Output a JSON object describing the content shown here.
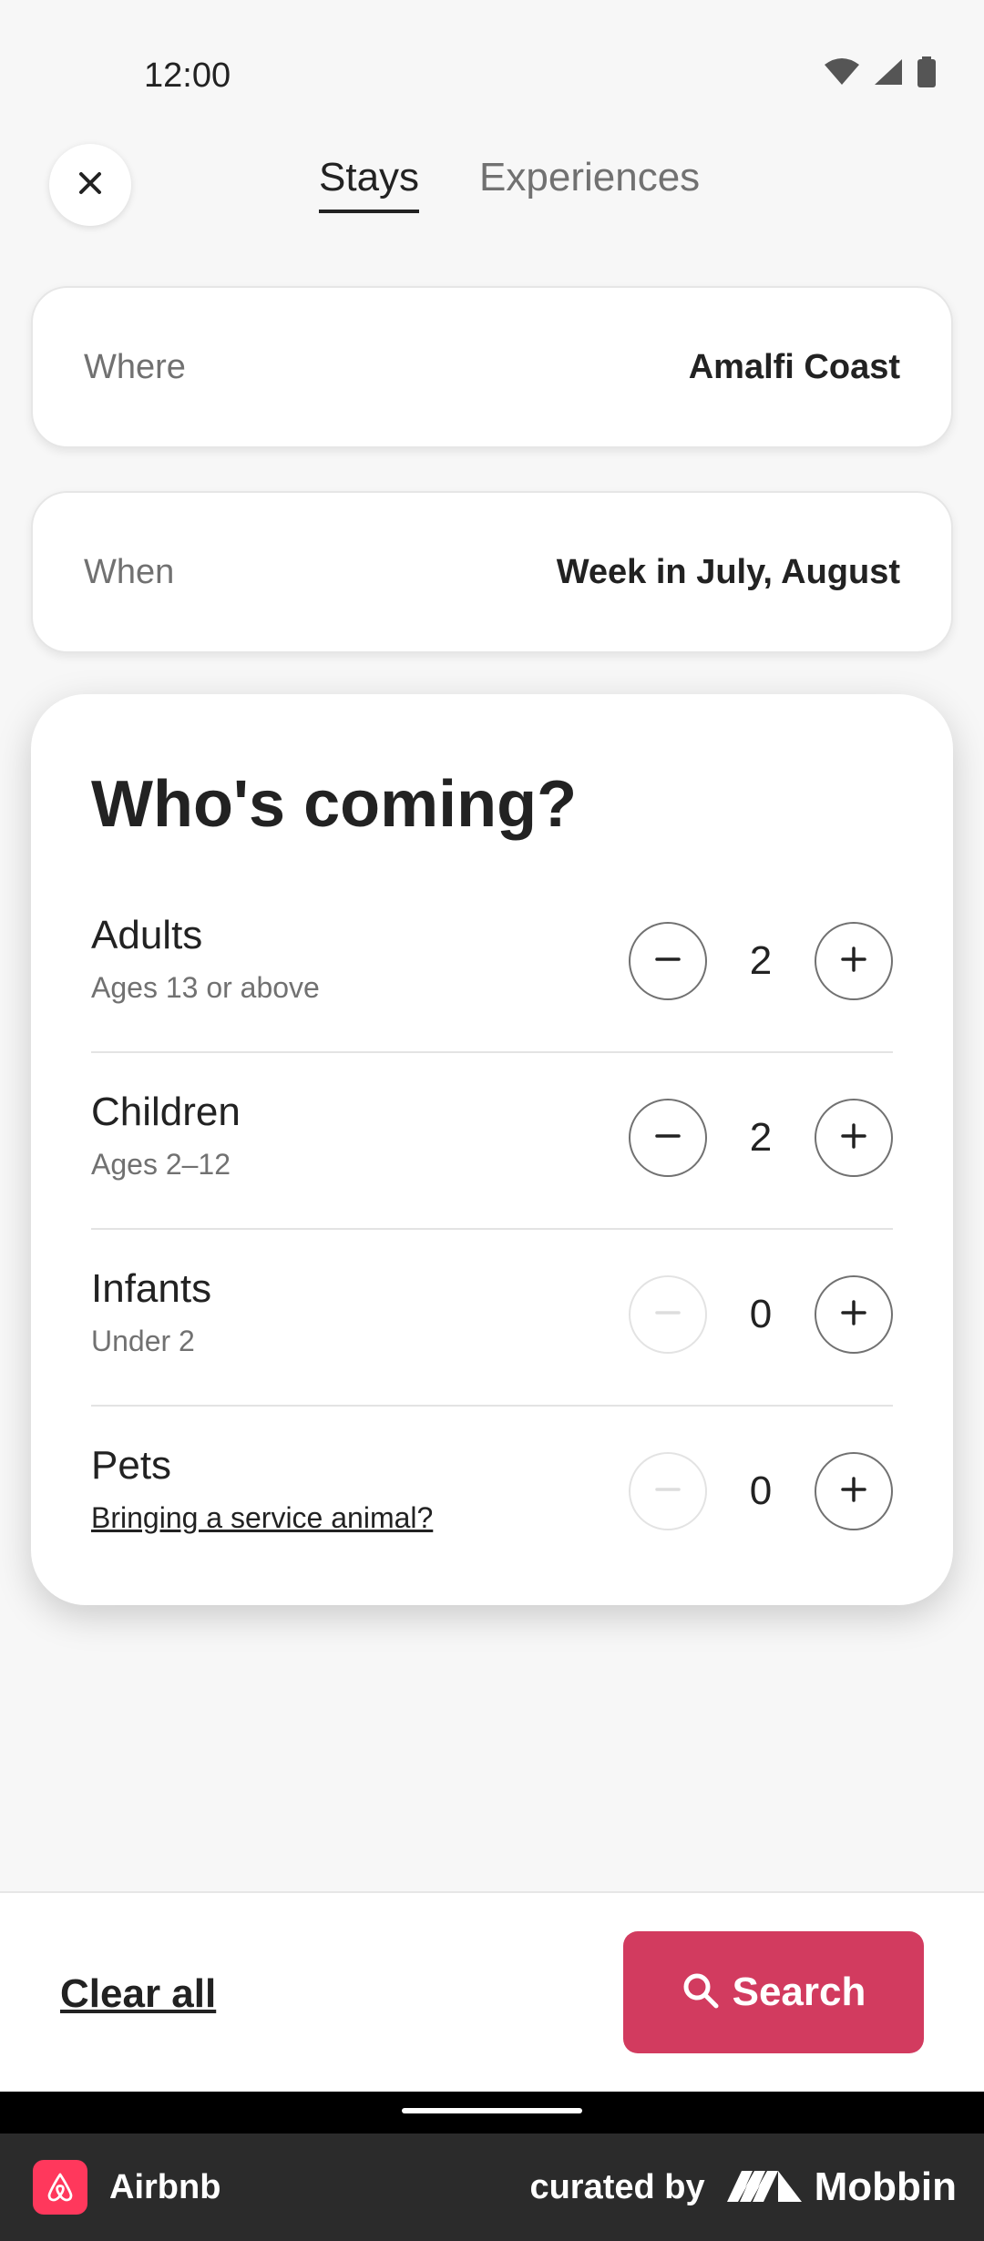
{
  "status_bar": {
    "time": "12:00"
  },
  "header": {
    "tabs": [
      {
        "label": "Stays",
        "active": true
      },
      {
        "label": "Experiences",
        "active": false
      }
    ]
  },
  "where": {
    "label": "Where",
    "value": "Amalfi Coast"
  },
  "when": {
    "label": "When",
    "value": "Week in July, August"
  },
  "guests": {
    "title": "Who's coming?",
    "rows": [
      {
        "label": "Adults",
        "sub": "Ages 13 or above",
        "count": "2",
        "minus_enabled": true
      },
      {
        "label": "Children",
        "sub": "Ages 2–12",
        "count": "2",
        "minus_enabled": true
      },
      {
        "label": "Infants",
        "sub": "Under 2",
        "count": "0",
        "minus_enabled": false
      },
      {
        "label": "Pets",
        "link": "Bringing a service animal?",
        "count": "0",
        "minus_enabled": false
      }
    ]
  },
  "bottom_bar": {
    "clear_label": "Clear all",
    "search_label": "Search",
    "accent": "#d23b5f"
  },
  "footer": {
    "app_name": "Airbnb",
    "curated": "curated by",
    "brand": "Mobbin"
  }
}
